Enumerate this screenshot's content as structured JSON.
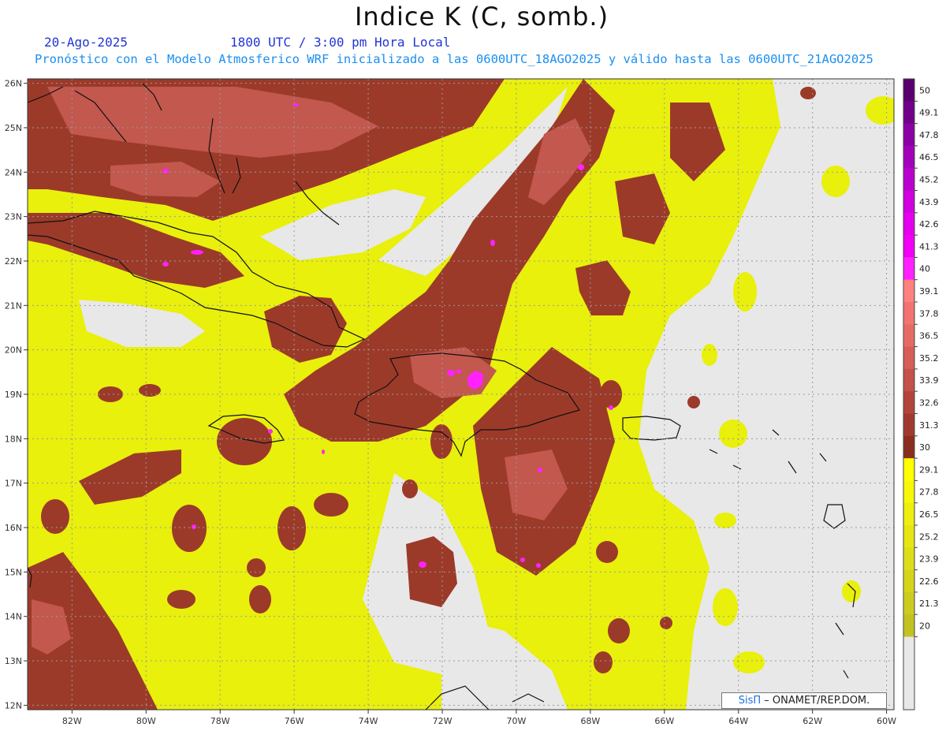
{
  "title": "Indice K (C, somb.)",
  "date": "20-Ago-2025",
  "time": "1800 UTC / 3:00 pm Hora Local",
  "model_line": "Pronóstico con el Modelo Atmosferico WRF inicializado a las 0600UTC_18AGO2025 y válido hasta las  0600UTC_21AGO2025",
  "credit": {
    "brand": "SisΠ",
    "org": " – ONAMET/REP.DOM."
  },
  "axes": {
    "lon_labels": [
      "82W",
      "80W",
      "78W",
      "76W",
      "74W",
      "72W",
      "70W",
      "68W",
      "66W",
      "64W",
      "62W",
      "60W"
    ],
    "lon_values": [
      -82,
      -80,
      -78,
      -76,
      -74,
      -72,
      -70,
      -68,
      -66,
      -64,
      -62,
      -60
    ],
    "lat_labels": [
      "26N",
      "25N",
      "24N",
      "23N",
      "22N",
      "21N",
      "20N",
      "19N",
      "18N",
      "17N",
      "16N",
      "15N",
      "14N",
      "13N",
      "12N"
    ],
    "lat_values": [
      26,
      25,
      24,
      23,
      22,
      21,
      20,
      19,
      18,
      17,
      16,
      15,
      14,
      13,
      12
    ],
    "lon_range": [
      -83.2,
      -59.8
    ],
    "lat_range": [
      11.9,
      26.1
    ]
  },
  "colorbar": {
    "labels": [
      "50",
      "49.1",
      "47.8",
      "46.5",
      "45.2",
      "43.9",
      "42.6",
      "41.3",
      "40",
      "39.1",
      "37.8",
      "36.5",
      "35.2",
      "33.9",
      "32.6",
      "31.3",
      "30",
      "29.1",
      "27.8",
      "26.5",
      "25.2",
      "23.9",
      "22.6",
      "21.3",
      "20"
    ],
    "colors": [
      "#5a006e",
      "#70008a",
      "#8a00a3",
      "#a200bb",
      "#ba00cf",
      "#d100e0",
      "#e400ee",
      "#f200f6",
      "#ff22ff",
      "#ff8080",
      "#f47372",
      "#e66a64",
      "#d65e56",
      "#c4514a",
      "#b3443c",
      "#a03a30",
      "#8a2e1e",
      "#ffff00",
      "#f7f70a",
      "#eeee10",
      "#e6e614",
      "#dede18",
      "#d5d51c",
      "#cccc20",
      "#c2c222"
    ],
    "bottom_color": "#e8e8e8"
  },
  "colors": {
    "background": "#e8e8e8",
    "k_20_30": "#e8f00c",
    "k_20_30_light": "#ffff2a",
    "k_30_40": "#9c3a2a",
    "k_35_40": "#c2584e",
    "k_40_plus": "#ff22ff",
    "coastline": "#111111"
  }
}
